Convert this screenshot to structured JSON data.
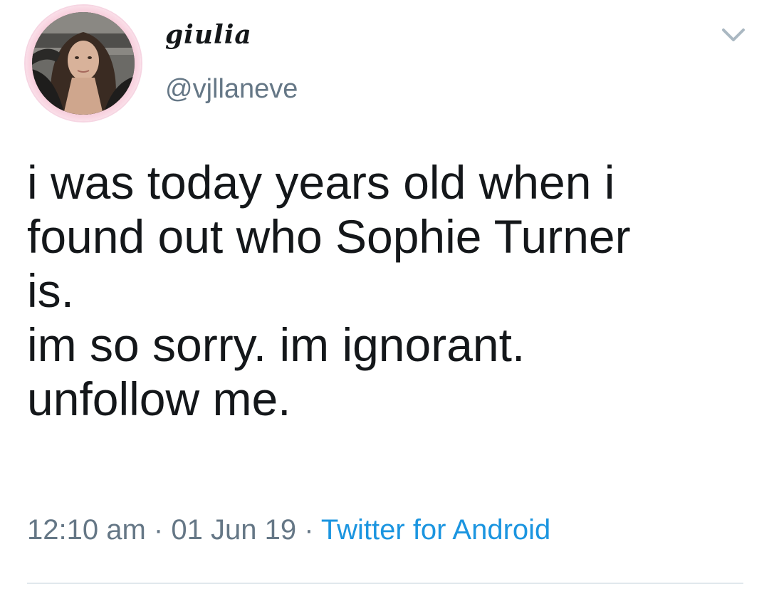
{
  "user": {
    "display_name": "giulia",
    "handle": "@vjllaneve"
  },
  "tweet": {
    "lines": [
      "i was today years old when i",
      "found out who Sophie Turner",
      "is.",
      "im so sorry. im ignorant.",
      "unfollow me."
    ],
    "time": "12:10 am",
    "separator": "·",
    "date": "01 Jun 19",
    "source": "Twitter for Android"
  },
  "icons": {
    "menu": "chevron-down-icon"
  },
  "colors": {
    "text": "#14171a",
    "secondary": "#657786",
    "link": "#1b95e0",
    "avatar_ring": "#f7c9d8"
  }
}
